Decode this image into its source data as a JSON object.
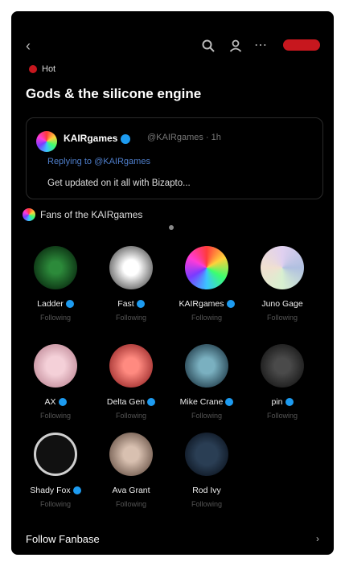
{
  "top_bar": {
    "icons": [
      "back-arrow-icon",
      "search-icon",
      "account-icon",
      "more-icon"
    ],
    "accent_color": "#c7171e"
  },
  "tag": {
    "label": "Hot"
  },
  "headline": "Gods & the silicone engine",
  "tweet": {
    "author": "KAIRgames",
    "handle": "@KAIRgames · 1h",
    "subline": "Replying to @KAIRgames",
    "body": "Get updated on it all with Bizapto..."
  },
  "section": {
    "title": "Fans of the KAIRgames"
  },
  "accounts": [
    {
      "name": "Ladder",
      "sub": "Following",
      "color": "#1e5c25"
    },
    {
      "name": "Fast",
      "sub": "Following",
      "color": "#d9d9d9"
    },
    {
      "name": "KAIRgames",
      "sub": "Following",
      "color": "rainbow"
    },
    {
      "name": "Juno Gage",
      "sub": "Following",
      "color": "#bfbfcf"
    },
    {
      "name": "AX",
      "sub": "Following",
      "color": "#e8b8c0"
    },
    {
      "name": "Delta Gen",
      "sub": "Following",
      "color": "#d45050"
    },
    {
      "name": "Mike Crane",
      "sub": "Following",
      "color": "#4a7a8a"
    },
    {
      "name": "pin",
      "sub": "Following",
      "color": "#3a3a3a"
    },
    {
      "name": "Shady Fox",
      "sub": "Following",
      "color": "#222222"
    },
    {
      "name": "Ava Grant",
      "sub": "Following",
      "color": "#a89080"
    },
    {
      "name": "Rod Ivy",
      "sub": "Following",
      "color": "#3a4a5c"
    }
  ],
  "footer": {
    "label": "Follow Fanbase",
    "arrow": "›"
  }
}
